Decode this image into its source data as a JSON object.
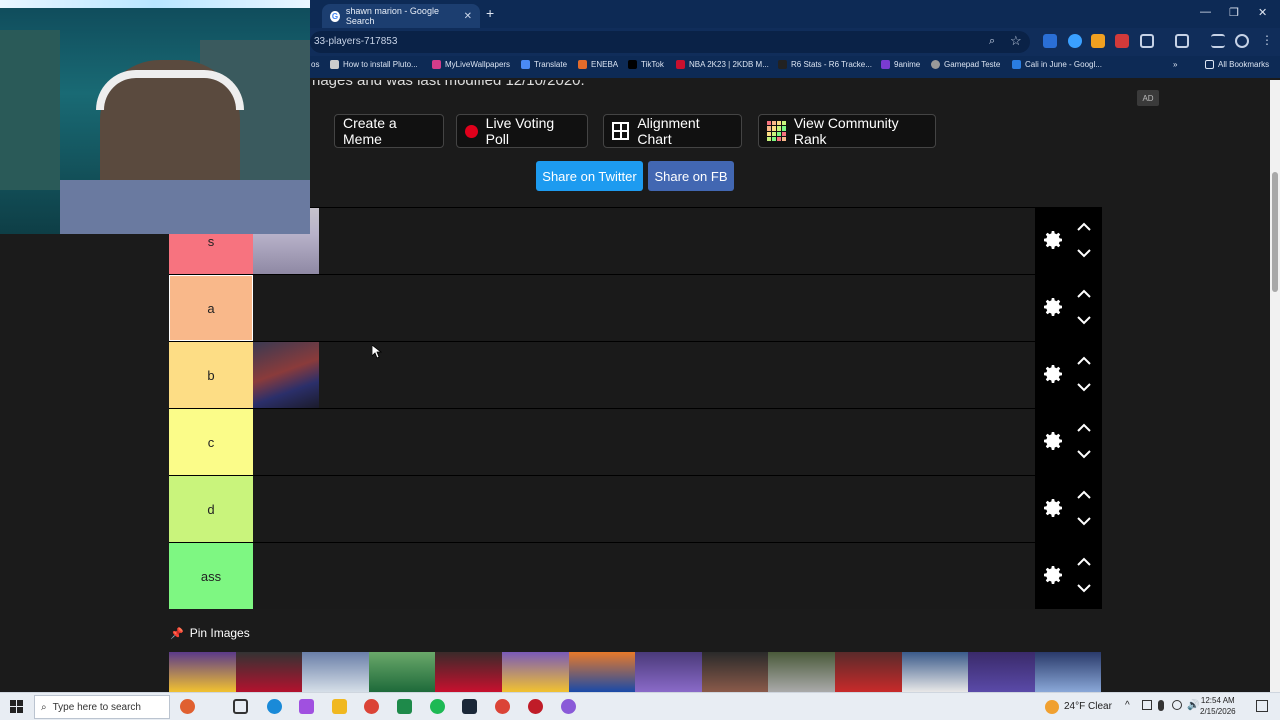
{
  "browser": {
    "tab_title": "shawn marion - Google Search",
    "url": "33-players-717853",
    "bookmarks": [
      "How to install Pluto...",
      "MyLiveWallpapers",
      "Translate",
      "ENEBA",
      "TikTok",
      "NBA 2K23 | 2KDB M...",
      "R6 Stats - R6 Tracke...",
      "9anime",
      "Gamepad Teste",
      "Cali in June - Googl...",
      "All Bookmarks"
    ],
    "bookmark_prefix": "os"
  },
  "page": {
    "cut_text": "nages and was last modified 12/10/2020.",
    "ad_badge": "AD",
    "buttons": {
      "meme": "Create a Meme",
      "poll": "Live Voting Poll",
      "alignment": "Alignment Chart",
      "community": "View Community Rank"
    },
    "share": {
      "twitter": "Share on Twitter",
      "fb": "Share on FB"
    },
    "tiers": [
      {
        "label": "s",
        "color": "#f7737f"
      },
      {
        "label": "a",
        "color": "#f9b88a"
      },
      {
        "label": "b",
        "color": "#fddd85"
      },
      {
        "label": "c",
        "color": "#fbfc89"
      },
      {
        "label": "d",
        "color": "#c9f47c"
      },
      {
        "label": "ass",
        "color": "#7ef782"
      }
    ],
    "pin_title": "Pin Images"
  },
  "taskbar": {
    "search_placeholder": "Type here to search",
    "weather": "24°F  Clear",
    "time": "12:54 AM",
    "date": "2/15/2026"
  }
}
